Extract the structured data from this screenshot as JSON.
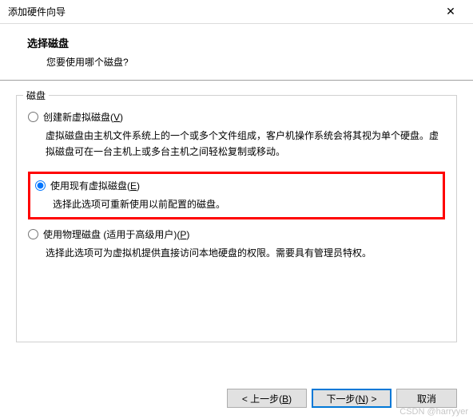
{
  "titlebar": {
    "title": "添加硬件向导",
    "close_label": "✕"
  },
  "header": {
    "title": "选择磁盘",
    "subtitle": "您要使用哪个磁盘?"
  },
  "group": {
    "legend": "磁盘",
    "options": [
      {
        "label_prefix": "创建新虚拟磁盘(",
        "hotkey": "V",
        "label_suffix": ")",
        "desc": "虚拟磁盘由主机文件系统上的一个或多个文件组成，客户机操作系统会将其视为单个硬盘。虚拟磁盘可在一台主机上或多台主机之间轻松复制或移动。"
      },
      {
        "label_prefix": "使用现有虚拟磁盘(",
        "hotkey": "E",
        "label_suffix": ")",
        "desc": "选择此选项可重新使用以前配置的磁盘。"
      },
      {
        "label_prefix": "使用物理磁盘 (适用于高级用户)(",
        "hotkey": "P",
        "label_suffix": ")",
        "desc": "选择此选项可为虚拟机提供直接访问本地硬盘的权限。需要具有管理员特权。"
      }
    ]
  },
  "footer": {
    "back_prefix": "< 上一步(",
    "back_hotkey": "B",
    "back_suffix": ")",
    "next_prefix": "下一步(",
    "next_hotkey": "N",
    "next_suffix": ") >",
    "cancel": "取消"
  },
  "watermark": "CSDN @harryyer"
}
